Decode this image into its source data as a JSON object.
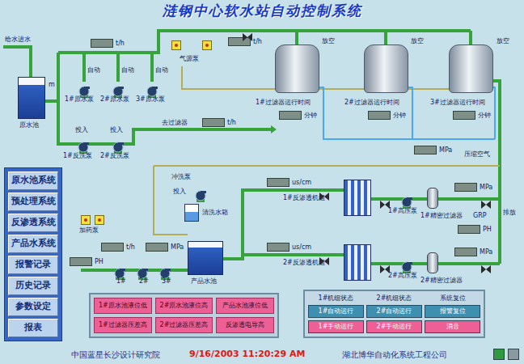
{
  "window": {
    "title": "涟钢中心软水站自动控制系统"
  },
  "sidebar": {
    "items": [
      {
        "label": "原水池系统"
      },
      {
        "label": "预处理系统"
      },
      {
        "label": "反渗透系统"
      },
      {
        "label": "产品水系统"
      },
      {
        "label": "报警记录"
      },
      {
        "label": "历史记录"
      },
      {
        "label": "参数设定"
      },
      {
        "label": "报表"
      }
    ]
  },
  "diagram": {
    "nodes": [
      {
        "kind": "label",
        "label": "给水进水"
      },
      {
        "kind": "label",
        "label": "m"
      },
      {
        "kind": "tank"
      },
      {
        "kind": "label",
        "label": "原水池"
      },
      {
        "kind": "pump"
      },
      {
        "kind": "pump"
      },
      {
        "kind": "pump"
      },
      {
        "kind": "label",
        "label": "1#原水泵"
      },
      {
        "kind": "label",
        "label": "2#原水泵"
      },
      {
        "kind": "label",
        "label": "3#原水泵"
      },
      {
        "kind": "label",
        "label": "自动"
      },
      {
        "kind": "label",
        "label": "自动"
      },
      {
        "kind": "label",
        "label": "自动"
      },
      {
        "kind": "lamp"
      },
      {
        "kind": "lamp"
      },
      {
        "kind": "label",
        "label": "气源泵"
      },
      {
        "kind": "readout",
        "unit": "t/h"
      },
      {
        "kind": "readout",
        "unit": "t/h"
      },
      {
        "kind": "vessel"
      },
      {
        "kind": "vessel"
      },
      {
        "kind": "vessel"
      },
      {
        "kind": "label",
        "label": "放空"
      },
      {
        "kind": "label",
        "label": "放空"
      },
      {
        "kind": "label",
        "label": "放空"
      },
      {
        "kind": "label",
        "label": "1#过滤器运行时间"
      },
      {
        "kind": "label",
        "label": "2#过滤器运行时间"
      },
      {
        "kind": "label",
        "label": "3#过滤器运行时间"
      },
      {
        "kind": "readout",
        "unit": "分钟"
      },
      {
        "kind": "readout",
        "unit": "分钟"
      },
      {
        "kind": "readout",
        "unit": "分钟"
      },
      {
        "kind": "pump"
      },
      {
        "kind": "pump"
      },
      {
        "kind": "label",
        "label": "1#反洗泵"
      },
      {
        "kind": "label",
        "label": "2#反洗泵"
      },
      {
        "kind": "label",
        "label": "投入"
      },
      {
        "kind": "label",
        "label": "投入"
      },
      {
        "kind": "label",
        "label": "去过滤器"
      },
      {
        "kind": "readout",
        "unit": "t/h"
      },
      {
        "kind": "label",
        "label": "压缩空气"
      },
      {
        "kind": "readout",
        "unit": "MPa"
      },
      {
        "kind": "label",
        "label": "冲洗泵"
      },
      {
        "kind": "pump"
      },
      {
        "kind": "label",
        "label": "投入"
      },
      {
        "kind": "basin"
      },
      {
        "kind": "label",
        "label": "清洗水箱"
      },
      {
        "kind": "readout",
        "unit": "us/cm"
      },
      {
        "kind": "label",
        "label": "1#反渗透机组"
      },
      {
        "kind": "rack"
      },
      {
        "kind": "rack"
      },
      {
        "kind": "readout",
        "unit": "us/cm"
      },
      {
        "kind": "label",
        "label": "2#反渗透机组"
      },
      {
        "kind": "pump"
      },
      {
        "kind": "pump"
      },
      {
        "kind": "label",
        "label": "1#高压泵"
      },
      {
        "kind": "label",
        "label": "2#高压泵"
      },
      {
        "kind": "cartridge"
      },
      {
        "kind": "cartridge"
      },
      {
        "kind": "label",
        "label": "1#精密过滤器"
      },
      {
        "kind": "label",
        "label": "2#精密过滤器"
      },
      {
        "kind": "readout",
        "unit": "MPa"
      },
      {
        "kind": "readout",
        "unit": "MPa"
      },
      {
        "kind": "label",
        "label": "排放"
      },
      {
        "kind": "label",
        "label": "GRP"
      },
      {
        "kind": "readout",
        "unit": "PH"
      },
      {
        "kind": "readout",
        "unit": "MPa"
      },
      {
        "kind": "readout",
        "unit": "t/h"
      },
      {
        "kind": "lamp"
      },
      {
        "kind": "lamp"
      },
      {
        "kind": "label",
        "label": "加药泵"
      },
      {
        "kind": "readout",
        "unit": "PH"
      },
      {
        "kind": "tank"
      },
      {
        "kind": "label",
        "label": "产品水池"
      },
      {
        "kind": "pump"
      },
      {
        "kind": "pump"
      },
      {
        "kind": "pump"
      },
      {
        "kind": "label",
        "label": "1#"
      },
      {
        "kind": "label",
        "label": "2#"
      },
      {
        "kind": "label",
        "label": "3#"
      },
      {
        "kind": "valve"
      },
      {
        "kind": "valve"
      },
      {
        "kind": "valve"
      },
      {
        "kind": "valve"
      },
      {
        "kind": "valve"
      },
      {
        "kind": "valve"
      },
      {
        "kind": "valve"
      }
    ]
  },
  "alarm_panel": {
    "buttons": [
      {
        "label": "1#原水池液位低"
      },
      {
        "label": "2#原水池液位高"
      },
      {
        "label": "产品水池液位低"
      },
      {
        "label": "1#过滤器压差高"
      },
      {
        "label": "2#过滤器压差高"
      },
      {
        "label": "反渗透电导高"
      }
    ]
  },
  "control_panel": {
    "headers": [
      "1#机组状态",
      "2#机组状态",
      "系统复位"
    ],
    "buttons": [
      {
        "label": "1#自动运行",
        "color": "#3f8fb0"
      },
      {
        "label": "2#自动运行",
        "color": "#3f8fb0"
      },
      {
        "label": "报警复位",
        "color": "#3f8fb0"
      },
      {
        "label": "1#手动运行",
        "color": "#ee5f95"
      },
      {
        "label": "2#手动运行",
        "color": "#ee5f95"
      },
      {
        "label": "消音",
        "color": "#ee5f95"
      }
    ]
  },
  "footer": {
    "left": "中国蓝星长沙设计研究院",
    "datetime": "9/16/2003 11:20:29 AM",
    "right": "湖北博华自动化系统工程公司"
  }
}
